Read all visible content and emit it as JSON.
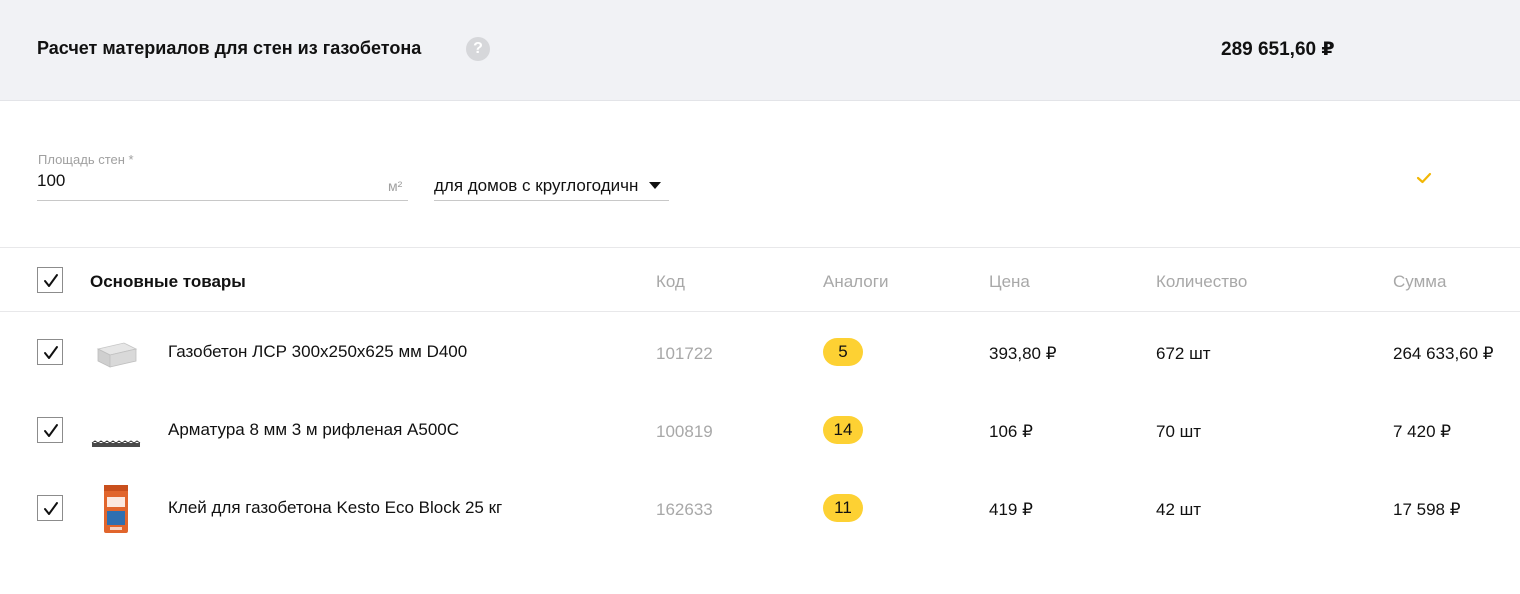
{
  "header": {
    "title": "Расчет материалов для стен из газобетона",
    "help_icon": "question-circle-icon",
    "help_glyph": "?",
    "total": "289 651,60 ₽"
  },
  "form": {
    "area_label": "Площадь стен *",
    "area_value": "100",
    "area_unit": "м²",
    "house_type_value": "для домов с круглогодичн",
    "confirm_icon": "checkmark-icon"
  },
  "table": {
    "group_title": "Основные товары",
    "columns": {
      "code": "Код",
      "analogs": "Аналоги",
      "price": "Цена",
      "quantity": "Количество",
      "sum": "Сумма"
    },
    "rows": [
      {
        "name": "Газобетон ЛСР 300х250х625 мм D400",
        "code": "101722",
        "analogs": "5",
        "price": "393,80 ₽",
        "quantity": "672 шт",
        "sum": "264 633,60 ₽",
        "checked": true,
        "thumb": "aerated-block-image"
      },
      {
        "name": "Арматура 8 мм 3 м рифленая А500С",
        "code": "100819",
        "analogs": "14",
        "price": "106 ₽",
        "quantity": "70 шт",
        "sum": "7 420 ₽",
        "checked": true,
        "thumb": "rebar-image"
      },
      {
        "name": "Клей для газобетона Kesto Eco Block 25 кг",
        "code": "162633",
        "analogs": "11",
        "price": "419 ₽",
        "quantity": "42 шт",
        "sum": "17 598 ₽",
        "checked": true,
        "thumb": "glue-bag-image"
      }
    ]
  },
  "colors": {
    "accent_yellow": "#fdd133",
    "header_bg": "#f1f2f5",
    "muted_text": "#a8a8a8"
  }
}
